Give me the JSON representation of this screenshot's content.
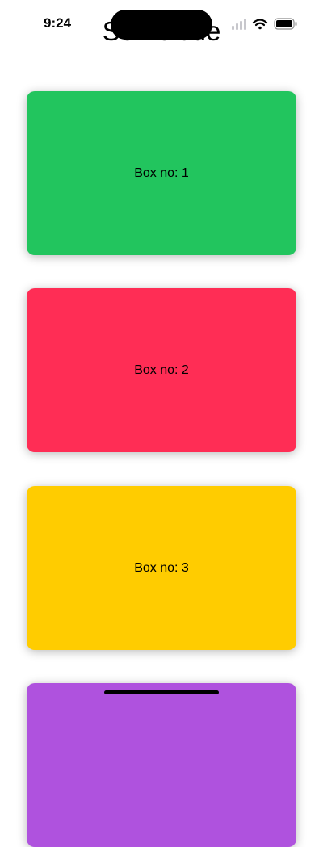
{
  "status_bar": {
    "time": "9:24",
    "icons": [
      "signal-icon",
      "wifi-icon",
      "battery-icon"
    ]
  },
  "page": {
    "title": "Some title"
  },
  "boxes": [
    {
      "label": "Box no: 1",
      "color": "#22C55E"
    },
    {
      "label": "Box no: 2",
      "color": "#FF2D55"
    },
    {
      "label": "Box no: 3",
      "color": "#FFCC00"
    },
    {
      "label": "",
      "color": "#AF52DE"
    }
  ]
}
